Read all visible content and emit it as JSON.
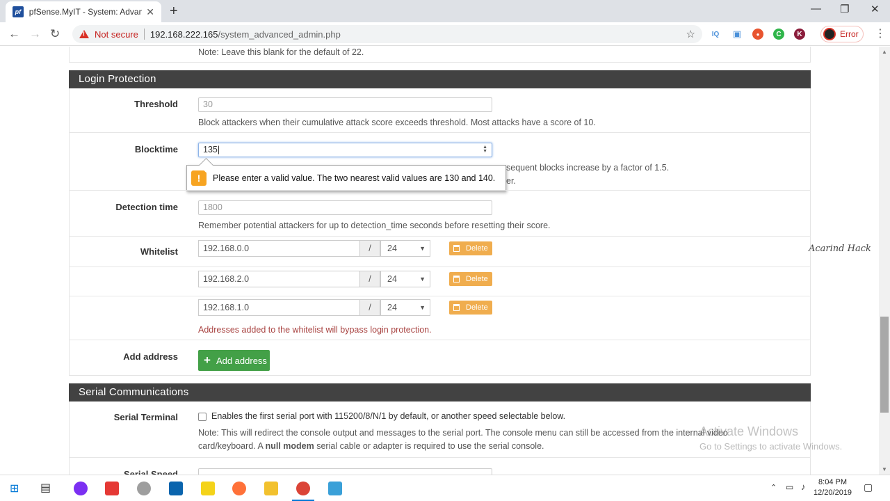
{
  "browser": {
    "tab_title": "pfSense.MyIT - System: Advanced",
    "tab_favicon": "pf",
    "url_host": "192.168.222.165",
    "url_path": "/system_advanced_admin.php",
    "security_label": "Not secure",
    "profile_status": "Error",
    "extensions": [
      {
        "name": "iq-extension-icon",
        "text": "IQ",
        "color": "#4a90d9"
      },
      {
        "name": "screen-extension-icon",
        "text": "▣",
        "color": "#4a90d9"
      },
      {
        "name": "fire-extension-icon",
        "text": "●",
        "color": "#e8542f"
      },
      {
        "name": "green-extension-icon",
        "text": "C",
        "color": "#2fb54a"
      },
      {
        "name": "k-extension-icon",
        "text": "K",
        "color": "#8a1c3b"
      }
    ]
  },
  "page": {
    "top_note": "Note: Leave this blank for the default of 22.",
    "login_protection": {
      "heading": "Login Protection",
      "threshold_label": "Threshold",
      "threshold_placeholder": "30",
      "threshold_help": "Block attackers when their cumulative attack score exceeds threshold. Most attacks have a score of 10.",
      "blocktime_label": "Blocktime",
      "blocktime_value": "135",
      "blocktime_help_1": "sequent blocks increase by a factor of 1.5.",
      "blocktime_help_2": "er.",
      "validation_message": "Please enter a valid value. The two nearest valid values are 130 and 140.",
      "detection_label": "Detection time",
      "detection_placeholder": "1800",
      "detection_help": "Remember potential attackers for up to detection_time seconds before resetting their score.",
      "whitelist_label": "Whitelist",
      "whitelist": [
        {
          "address": "192.168.0.0",
          "slash": "/",
          "mask": "24",
          "delete_label": "Delete"
        },
        {
          "address": "192.168.2.0",
          "slash": "/",
          "mask": "24",
          "delete_label": "Delete"
        },
        {
          "address": "192.168.1.0",
          "slash": "/",
          "mask": "24",
          "delete_label": "Delete"
        }
      ],
      "whitelist_warning": "Addresses added to the whitelist will bypass login protection.",
      "add_address_label": "Add address",
      "add_address_button": "Add address"
    },
    "serial": {
      "heading": "Serial Communications",
      "terminal_label": "Serial Terminal",
      "terminal_text": "Enables the first serial port with 115200/8/N/1 by default, or another speed selectable below.",
      "note_line1": "Note: This will redirect the console output and messages to the serial port. The console menu can still be accessed from the internal video",
      "note_line2_pre": "card/keyboard. A ",
      "note_line2_bold": "null modem",
      "note_line2_post": " serial cable or adapter is required to use the serial console.",
      "speed_label": "Serial Speed"
    },
    "overlay": {
      "activate_title": "Activate Windows",
      "activate_sub": "Go to Settings to activate Windows.",
      "signature": "Acarind Hack"
    }
  },
  "taskbar": {
    "time": "8:04 PM",
    "date": "12/20/2019"
  },
  "colors": {
    "panel_heading": "#424242",
    "delete_button": "#f0ad4e",
    "add_button": "#43a047",
    "warning_text": "#a94442"
  }
}
